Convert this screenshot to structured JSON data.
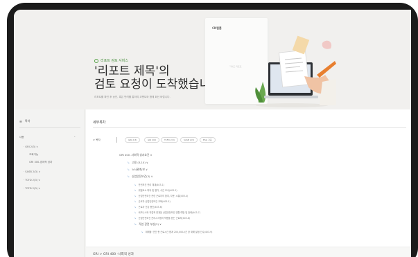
{
  "hero": {
    "service_tag": "리포트 검토 서비스",
    "title_line1": "'리포트 제목'의",
    "title_line2": "검토 요청이 도착했습니다.",
    "description": "리포트를 확인 후 승인, 혹은 반려를 통하여 코멘트와 함께 회신 바랍니다.",
    "doc_logo": "CN랩톱",
    "doc_sub": "가이드 리포트"
  },
  "sidebar": {
    "heading": "목차",
    "items": [
      {
        "label": "내용"
      },
      {
        "label": "· GRI 2(3) ∨"
      },
      {
        "label": "조회가능"
      },
      {
        "label": "GRI 300-경제적 성과"
      },
      {
        "label": "· SASB 2(3) ∨"
      },
      {
        "label": "· TCFD 2(3) ∨"
      },
      {
        "label": "· TCFD 2(3) ∨"
      }
    ]
  },
  "main": {
    "title": "세부목차",
    "tree_label": "> 목차",
    "chips": [
      "GRI 2(3)",
      "GRI 200",
      "TCFD 2(3)",
      "SASB 2(3)",
      "ESG 기준"
    ],
    "tree": [
      {
        "text": "GRI 400 -사회적 성과요건 ∨",
        "level": 0
      },
      {
        "text": "고용 (3,10) ∨",
        "level": 1
      },
      {
        "text": "노사관계/보 ∨",
        "level": 1
      },
      {
        "text": "산업안전보건(3) ∨",
        "level": 1
      },
      {
        "text": "안전보건 관리 체계(403-1)",
        "level": 2
      },
      {
        "text": "위험요소 파악 및 평가, 사건 조사(403-2)",
        "level": 2
      },
      {
        "text": "산업안전보건 관련 근로자의 참여, 자문, 소통(403-4)",
        "level": 2
      },
      {
        "text": "근로자 산업안전보건 교육(403-5)",
        "level": 2
      },
      {
        "text": "근로자 건강 증진(403-6)",
        "level": 2
      },
      {
        "text": "비즈니스와 직접적 연계된 산업안전보건 영향 예방 및 완화(403-7)",
        "level": 2
      },
      {
        "text": "산업안전보건 관리시스템의 적용을 받는 근로자(403-8)",
        "level": 2
      },
      {
        "text": "작업 관련 부상(3) ∨",
        "level": 1
      },
      {
        "text": "재해율: 연간 총 근로시간 합계 200,000시간 당 재해 발생 건수(403-9)",
        "level": 2
      }
    ],
    "bottom_title": "GRI > GRI 400 -사회적 성과"
  }
}
